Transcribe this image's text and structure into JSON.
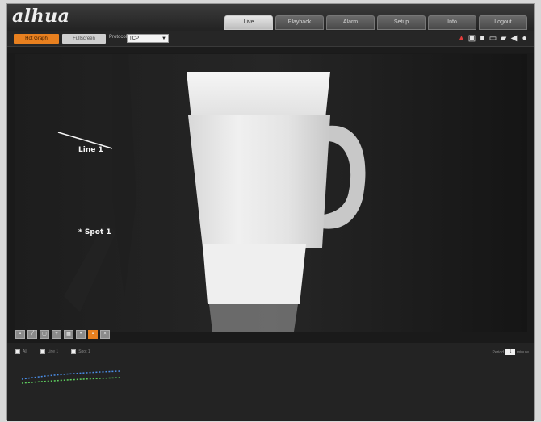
{
  "header": {
    "logo": "alhua",
    "tabs": [
      {
        "label": "Live",
        "active": true
      },
      {
        "label": "Playback",
        "active": false
      },
      {
        "label": "Alarm",
        "active": false
      },
      {
        "label": "Setup",
        "active": false
      },
      {
        "label": "Info",
        "active": false
      },
      {
        "label": "Logout",
        "active": false
      }
    ]
  },
  "toolbar": {
    "hot_button": "Hot Graph",
    "fullscreen_button": "Fullscreen",
    "protocol_label": "Protocol",
    "protocol_value": "TCP",
    "icons": [
      "record-icon",
      "stream-icon",
      "snapshot-icon",
      "monitor-icon",
      "folder-icon",
      "audio-icon",
      "settings-icon"
    ]
  },
  "video": {
    "line_label": "Line 1",
    "spot_label": "* Spot 1"
  },
  "video_controls": [
    "rule-icon",
    "line-icon",
    "area-icon",
    "zoom-icon",
    "grid-icon",
    "spot-icon",
    "active-icon",
    "clear-icon"
  ],
  "lower": {
    "legend": [
      "All",
      "Line 1",
      "Spot 1"
    ],
    "period_label": "Period",
    "period_value": "1",
    "period_unit": "minute"
  },
  "colors": {
    "accent": "#e8801f",
    "trend_green": "#5fd05f",
    "trend_blue": "#4a8ee8"
  }
}
